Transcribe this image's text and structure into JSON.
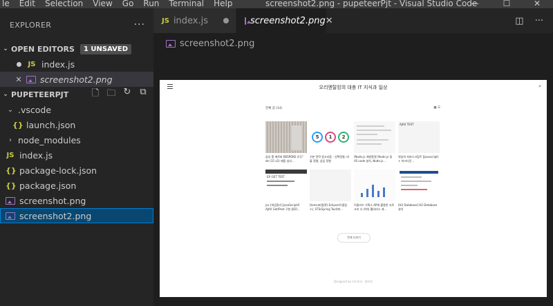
{
  "titlebar": {
    "menu": [
      "le",
      "Edit",
      "Selection",
      "View",
      "Go",
      "Run",
      "Terminal",
      "Help"
    ],
    "window_title": "screenshot2.png - pupeteerPjt - Visual Studio Code",
    "controls": {
      "minimize": "—",
      "maximize": "☐",
      "close": "✕"
    }
  },
  "sidebar": {
    "title": "EXPLORER",
    "more": "···",
    "open_editors": {
      "label": "OPEN EDITORS",
      "badge": "1 UNSAVED",
      "items": [
        {
          "name": "index.js",
          "type": "js",
          "indicator": "dot"
        },
        {
          "name": "screenshot2.png",
          "type": "image",
          "indicator": "close",
          "close_glyph": "✕"
        }
      ]
    },
    "folder": {
      "label": "PUPETEERPJT",
      "actions": [
        "new-file",
        "new-folder",
        "refresh",
        "collapse"
      ],
      "items": [
        {
          "name": ".vscode",
          "kind": "folder",
          "expanded": true,
          "chevron": "⌄"
        },
        {
          "name": "launch.json",
          "kind": "json",
          "depth": 1
        },
        {
          "name": "node_modules",
          "kind": "folder",
          "expanded": false,
          "chevron": "›"
        },
        {
          "name": "index.js",
          "kind": "js"
        },
        {
          "name": "package-lock.json",
          "kind": "json"
        },
        {
          "name": "package.json",
          "kind": "json"
        },
        {
          "name": "screenshot.png",
          "kind": "image"
        },
        {
          "name": "screenshot2.png",
          "kind": "image",
          "selected": true
        }
      ]
    }
  },
  "tabs": [
    {
      "label": "index.js",
      "type": "js",
      "active": false,
      "dirty": true
    },
    {
      "label": "screenshot2.png",
      "type": "image",
      "active": true
    }
  ],
  "editor_actions": [
    "split-editor-icon",
    "more-actions-icon"
  ],
  "breadcrumb": "screenshot2.png",
  "preview": {
    "site_title": "오리엔탈킹의 대충 IT 지식과 일상",
    "list_heading": "전체 글 (14)",
    "cards": [
      {
        "title": "삼성 홈 캐로파 BESPOKE 유무\" de (15 x2) 제품 실사..."
      },
      {
        "title": "기본 전략 알고리즘 - 선택정렬, 버블 정렬, 삽입 정렬"
      },
      {
        "title": "[Node.js 개발환경] Node.js 및 VS code 설치, Node.js..."
      },
      {
        "title": "워실의 자바스크립트 [Javascript] + 마크다운..."
      },
      {
        "title": "jsx [개념정리] JavaScript로 AJAX Get/Post 구현 (JSO..."
      },
      {
        "title": "[tomcat(톰캣) Eclipse(이클립스), STS(Spring Tool)에..."
      },
      {
        "title": "이클리즈 기획소 AP에 활용한 서로크리 너 (여의 웰서비스 개..."
      },
      {
        "title": "[H2 Database] H2 Database 설치"
      }
    ],
    "thumb_labels": {
      "circles": [
        "5",
        "1",
        "2"
      ],
      "ajax_caption": "AJAX TEST",
      "ex_caption": "EX GET TEST"
    },
    "more_button": "전체 더보기",
    "footer": "Designed by 티스토리 · 관리자"
  },
  "colors": {
    "titlebar_bg": "#3c3c3c",
    "sidebar_bg": "#252526",
    "editor_bg": "#1e1e1e",
    "selection_bg": "#094771",
    "selection_border": "#007fd4",
    "js_icon": "#cbcb41",
    "image_icon": "#a074c4"
  }
}
